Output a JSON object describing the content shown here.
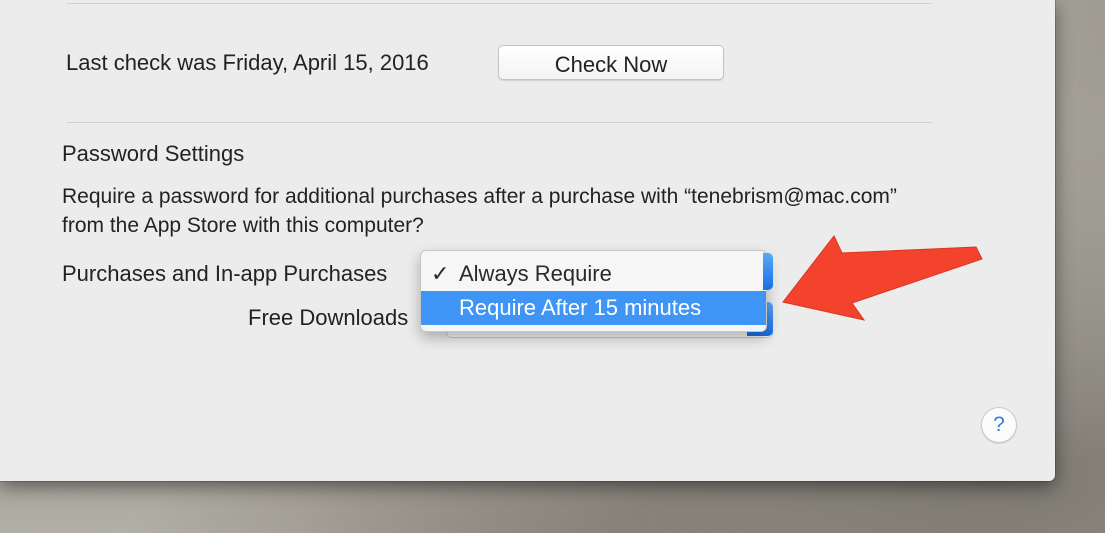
{
  "update": {
    "last_check": "Last check was Friday, April 15, 2016",
    "check_now_label": "Check Now"
  },
  "password_settings": {
    "heading": "Password Settings",
    "description_line1": "Require a password for additional purchases after a purchase with “tenebrism@mac.com”",
    "description_line2": "from the App Store with this computer?",
    "purchases_label": "Purchases and In-app Purchases",
    "free_downloads_label": "Free Downloads"
  },
  "popup_menu": {
    "items": [
      {
        "label": "Always Require",
        "checked": true,
        "highlighted": false,
        "check_mark": "✓"
      },
      {
        "label": "Require After 15 minutes",
        "checked": false,
        "highlighted": true,
        "check_mark": ""
      }
    ]
  },
  "help_button": {
    "glyph": "?"
  },
  "colors": {
    "accent": "#3f95f5",
    "annotation_arrow": "#f4432c",
    "window_background": "#ececec"
  },
  "icons": {
    "help": "help-question-icon",
    "annotation": "red-arrow-icon",
    "checkmark": "checkmark-icon"
  }
}
